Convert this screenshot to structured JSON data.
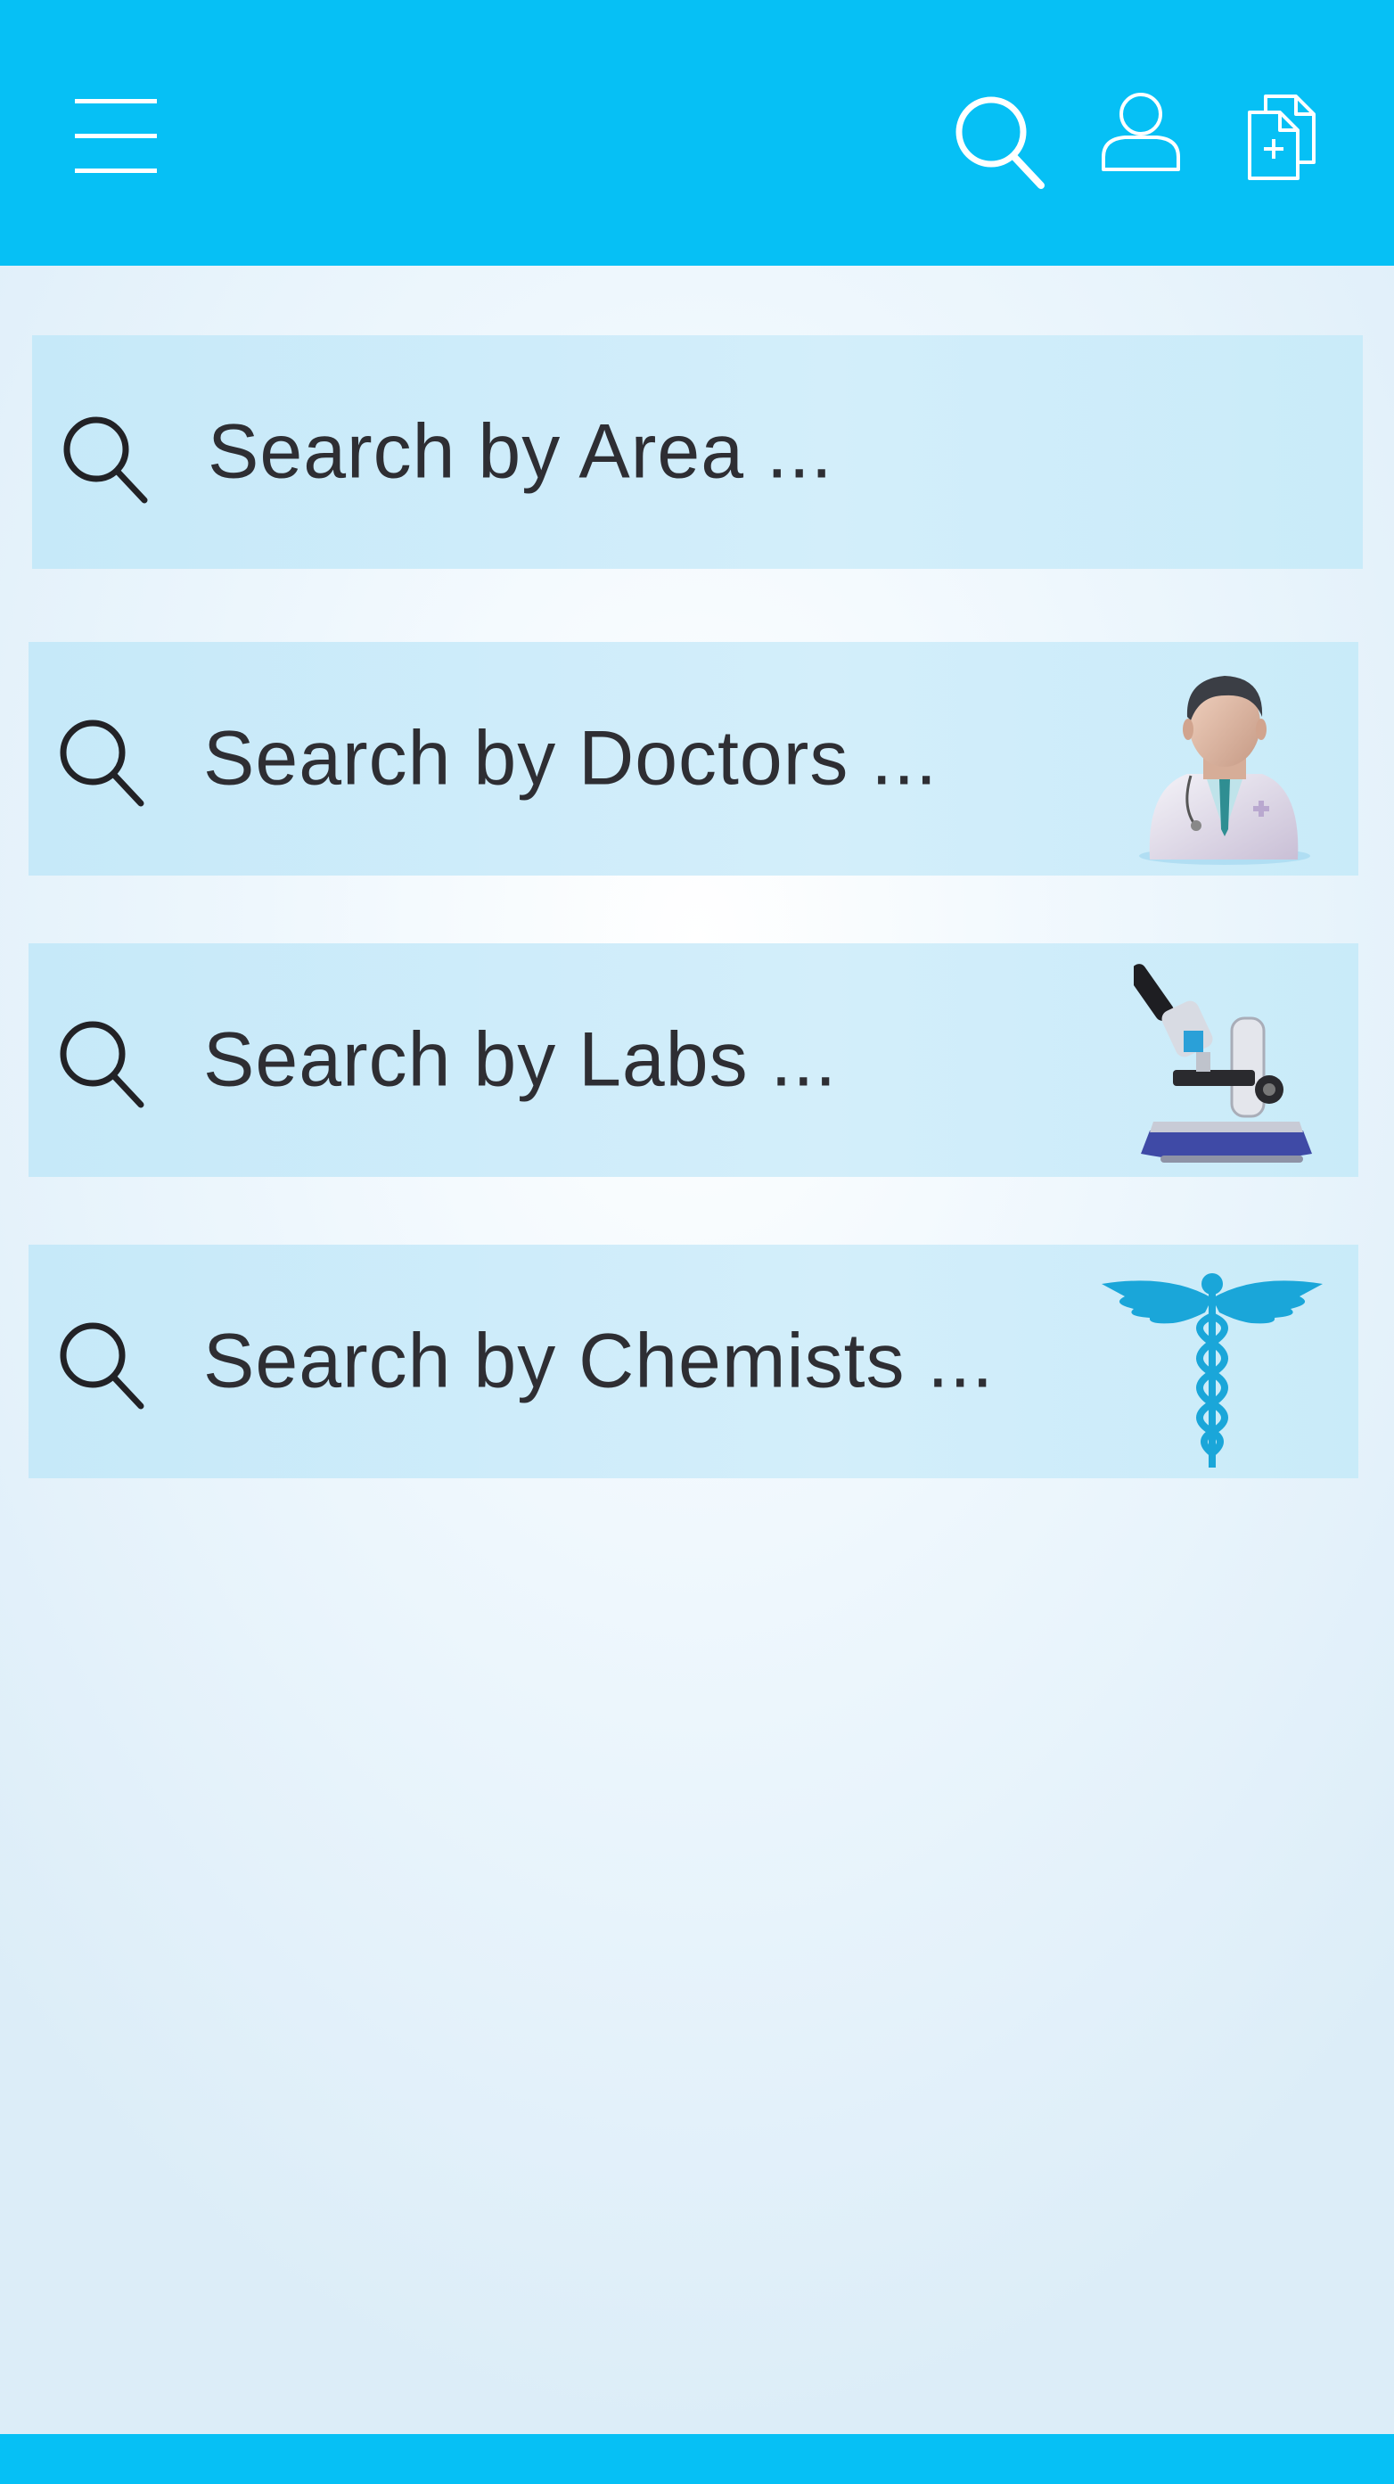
{
  "header": {
    "background_color": "#06c0f5",
    "menu_icon": "hamburger-menu-icon",
    "actions": [
      {
        "icon": "search-icon"
      },
      {
        "icon": "user-profile-icon"
      },
      {
        "icon": "add-document-icon"
      }
    ]
  },
  "search_options": [
    {
      "placeholder": "Search by Area ...",
      "icon": "search-icon",
      "image": null
    },
    {
      "placeholder": "Search by Doctors ...",
      "icon": "search-icon",
      "image": "doctor-icon"
    },
    {
      "placeholder": "Search by Labs ...",
      "icon": "search-icon",
      "image": "microscope-icon"
    },
    {
      "placeholder": "Search by Chemists ...",
      "icon": "search-icon",
      "image": "caduceus-icon"
    }
  ],
  "footer": {
    "background_color": "#06c0f5"
  }
}
